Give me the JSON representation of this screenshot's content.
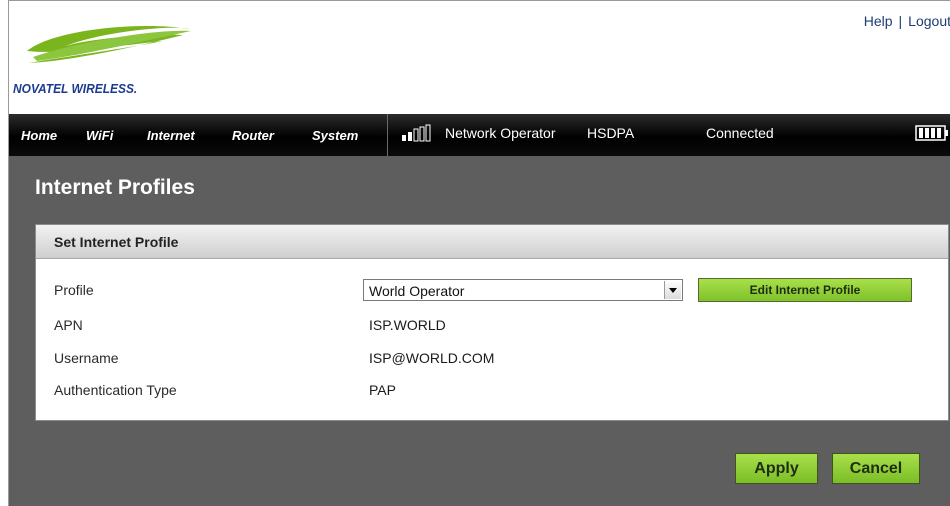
{
  "brand": {
    "logo_text": "NOVATEL WIRELESS."
  },
  "top_links": {
    "help": "Help",
    "separator": "|",
    "logout": "Logout"
  },
  "nav": {
    "items": [
      "Home",
      "WiFi",
      "Internet",
      "Router",
      "System"
    ]
  },
  "status": {
    "operator": "Network Operator",
    "network_type": "HSDPA",
    "connection": "Connected",
    "signal_bars_filled": 2,
    "signal_bars_total": 5,
    "battery_level": 1.0
  },
  "page": {
    "title": "Internet Profiles"
  },
  "panel": {
    "title": "Set Internet Profile",
    "fields": [
      {
        "label": "Profile",
        "value": "World Operator"
      },
      {
        "label": "APN",
        "value": "ISP.WORLD"
      },
      {
        "label": "Username",
        "value": "ISP@WORLD.COM"
      },
      {
        "label": "Authentication Type",
        "value": "PAP"
      }
    ],
    "edit_button": "Edit Internet Profile"
  },
  "actions": {
    "apply": "Apply",
    "cancel": "Cancel"
  },
  "colors": {
    "nav_background": "#000000",
    "content_background": "#5e5e5e",
    "button_green": "#8fce36",
    "logo_green": "#7ab51d",
    "logo_blue": "#1d3c8f"
  },
  "icons": [
    "logo-swoosh",
    "signal-strength-icon",
    "battery-icon",
    "dropdown-arrow-icon"
  ]
}
